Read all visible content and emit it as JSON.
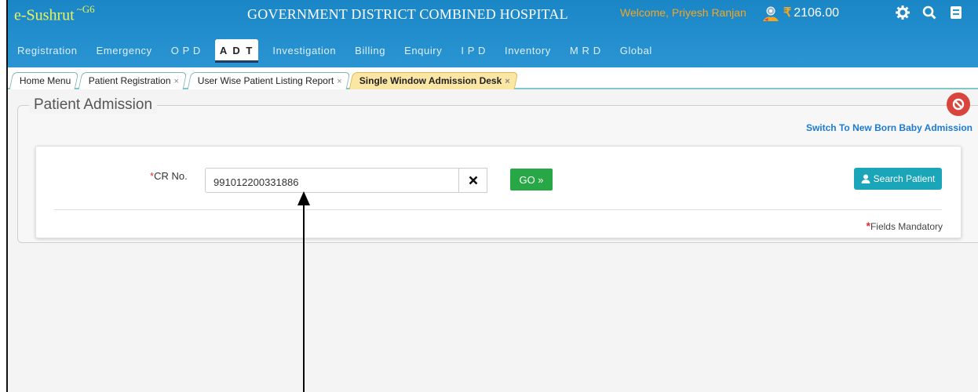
{
  "header": {
    "brand": "e-Sushrut",
    "brand_suffix": "~G6",
    "hospital_name": "GOVERNMENT DISTRICT COMBINED HOSPITAL",
    "welcome_text": "Welcome, Priyesh Ranjan",
    "currency_symbol": "₹",
    "balance": "2106.00",
    "icons": [
      "user-badge-icon",
      "gear-icon",
      "search-icon",
      "book-icon"
    ]
  },
  "nav": {
    "items": [
      {
        "label": "Registration"
      },
      {
        "label": "Emergency"
      },
      {
        "label": "O P D"
      },
      {
        "label": "A D T",
        "active": true
      },
      {
        "label": "Investigation"
      },
      {
        "label": "Billing"
      },
      {
        "label": "Enquiry"
      },
      {
        "label": "I P D"
      },
      {
        "label": "Inventory"
      },
      {
        "label": "M R D"
      },
      {
        "label": "Global"
      }
    ]
  },
  "tabs": [
    {
      "label": "Home Menu",
      "closable": false
    },
    {
      "label": "Patient Registration",
      "closable": true
    },
    {
      "label": "User Wise Patient Listing Report",
      "closable": true
    },
    {
      "label": "Single Window Admission Desk",
      "closable": true,
      "active": true
    }
  ],
  "tab_close_glyph": "×",
  "panel": {
    "title": "Patient Admission",
    "switch_link": "Switch To New Born Baby Admission"
  },
  "form": {
    "required_mark": "*",
    "cr_label": "CR No.",
    "cr_value": "991012200331886",
    "go_label": "GO »",
    "search_label": "Search Patient",
    "mandatory_mark": "*",
    "mandatory_text": "Fields Mandatory"
  },
  "colors": {
    "header_blue": "#1a86c6",
    "brand_yellow": "#e9f25a",
    "welcome_orange": "#f5a623",
    "active_tab": "#fbe6a4",
    "go_green": "#27a745",
    "search_teal": "#1aa5b8",
    "stop_red": "#d9453d",
    "link_blue": "#1b7bd3"
  }
}
